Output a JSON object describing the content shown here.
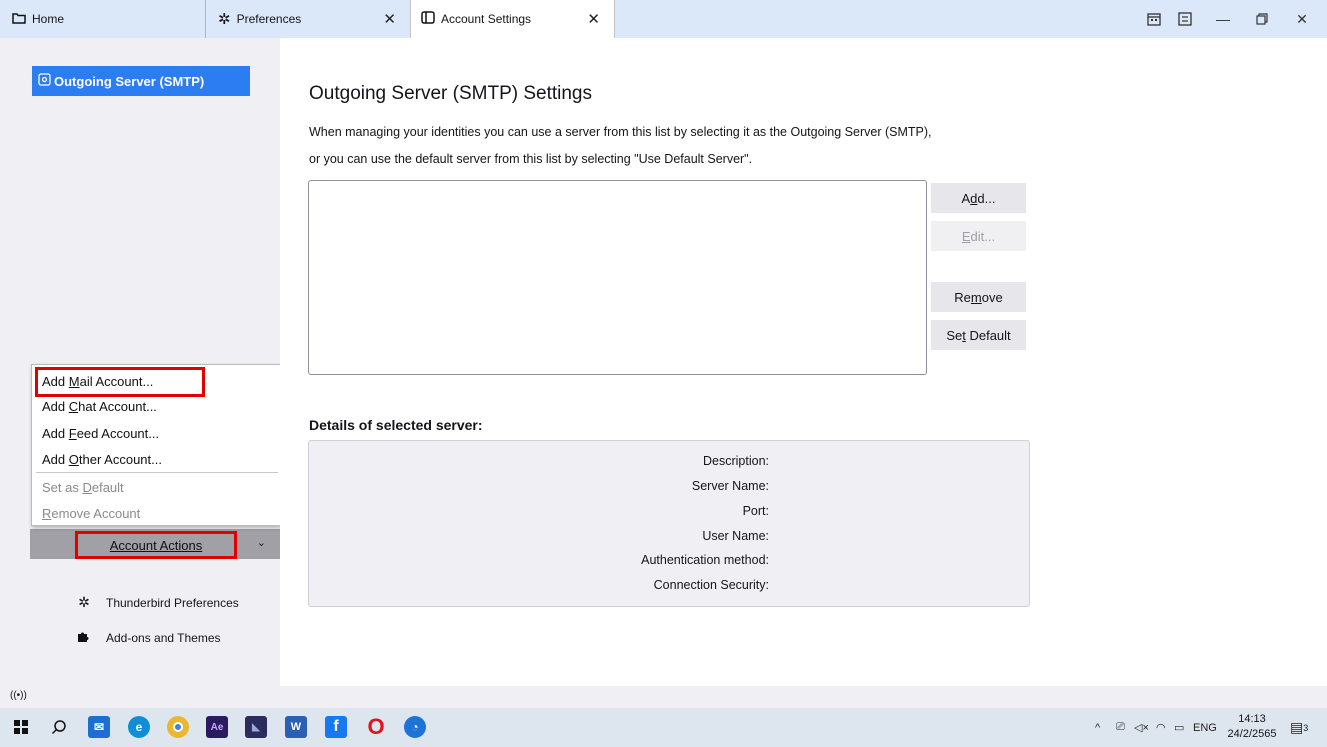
{
  "tabs": {
    "home": {
      "label": "Home",
      "icon": "folder-icon"
    },
    "preferences": {
      "label": "Preferences",
      "icon": "gear-icon"
    },
    "account_settings": {
      "label": "Account Settings",
      "icon": "account-settings-icon"
    }
  },
  "window_controls": [
    "calendar-icon",
    "tasks-icon",
    "minimize-icon",
    "restore-icon",
    "close-icon"
  ],
  "sidebar": {
    "selected_item": "Outgoing Server (SMTP)",
    "account_actions_label": "Account Actions",
    "links": [
      {
        "label": "Thunderbird Preferences",
        "icon": "gear-icon"
      },
      {
        "label": "Add-ons and Themes",
        "icon": "puzzle-icon"
      }
    ]
  },
  "account_menu": {
    "items": [
      {
        "pre": "Add ",
        "key": "M",
        "post": "ail Account...",
        "disabled": false
      },
      {
        "pre": "Add ",
        "key": "C",
        "post": "hat Account...",
        "disabled": false
      },
      {
        "pre": "Add ",
        "key": "F",
        "post": "eed Account...",
        "disabled": false
      },
      {
        "pre": "Add ",
        "key": "O",
        "post": "ther Account...",
        "disabled": false
      },
      {
        "pre": "Set as ",
        "key": "D",
        "post": "efault",
        "disabled": true
      },
      {
        "pre": "",
        "key": "R",
        "post": "emove Account",
        "disabled": true
      }
    ]
  },
  "main": {
    "title": "Outgoing Server (SMTP) Settings",
    "description_line1": "When managing your identities you can use a server from this list by selecting it as the Outgoing Server (SMTP),",
    "description_line2": "or you can use the default server from this list by selecting \"Use Default Server\".",
    "buttons": {
      "add": {
        "pre": "A",
        "key": "d",
        "post": "d..."
      },
      "edit": {
        "pre": "",
        "key": "E",
        "post": "dit..."
      },
      "remove": {
        "pre": "Re",
        "key": "m",
        "post": "ove"
      },
      "set_default": {
        "pre": "Se",
        "key": "t",
        "post": " Default"
      }
    },
    "details_title": "Details of selected server:",
    "details_labels": [
      "Description:",
      "Server Name:",
      "Port:",
      "User Name:",
      "Authentication method:",
      "Connection Security:"
    ]
  },
  "taskbar": {
    "tray_lang": "ENG",
    "clock_time": "14:13",
    "clock_date": "24/2/2565",
    "notification_count": "3"
  },
  "colors": {
    "accent": "#2d7df2",
    "highlight_box": "#e00000",
    "tabbar": "#dbe8f9"
  }
}
